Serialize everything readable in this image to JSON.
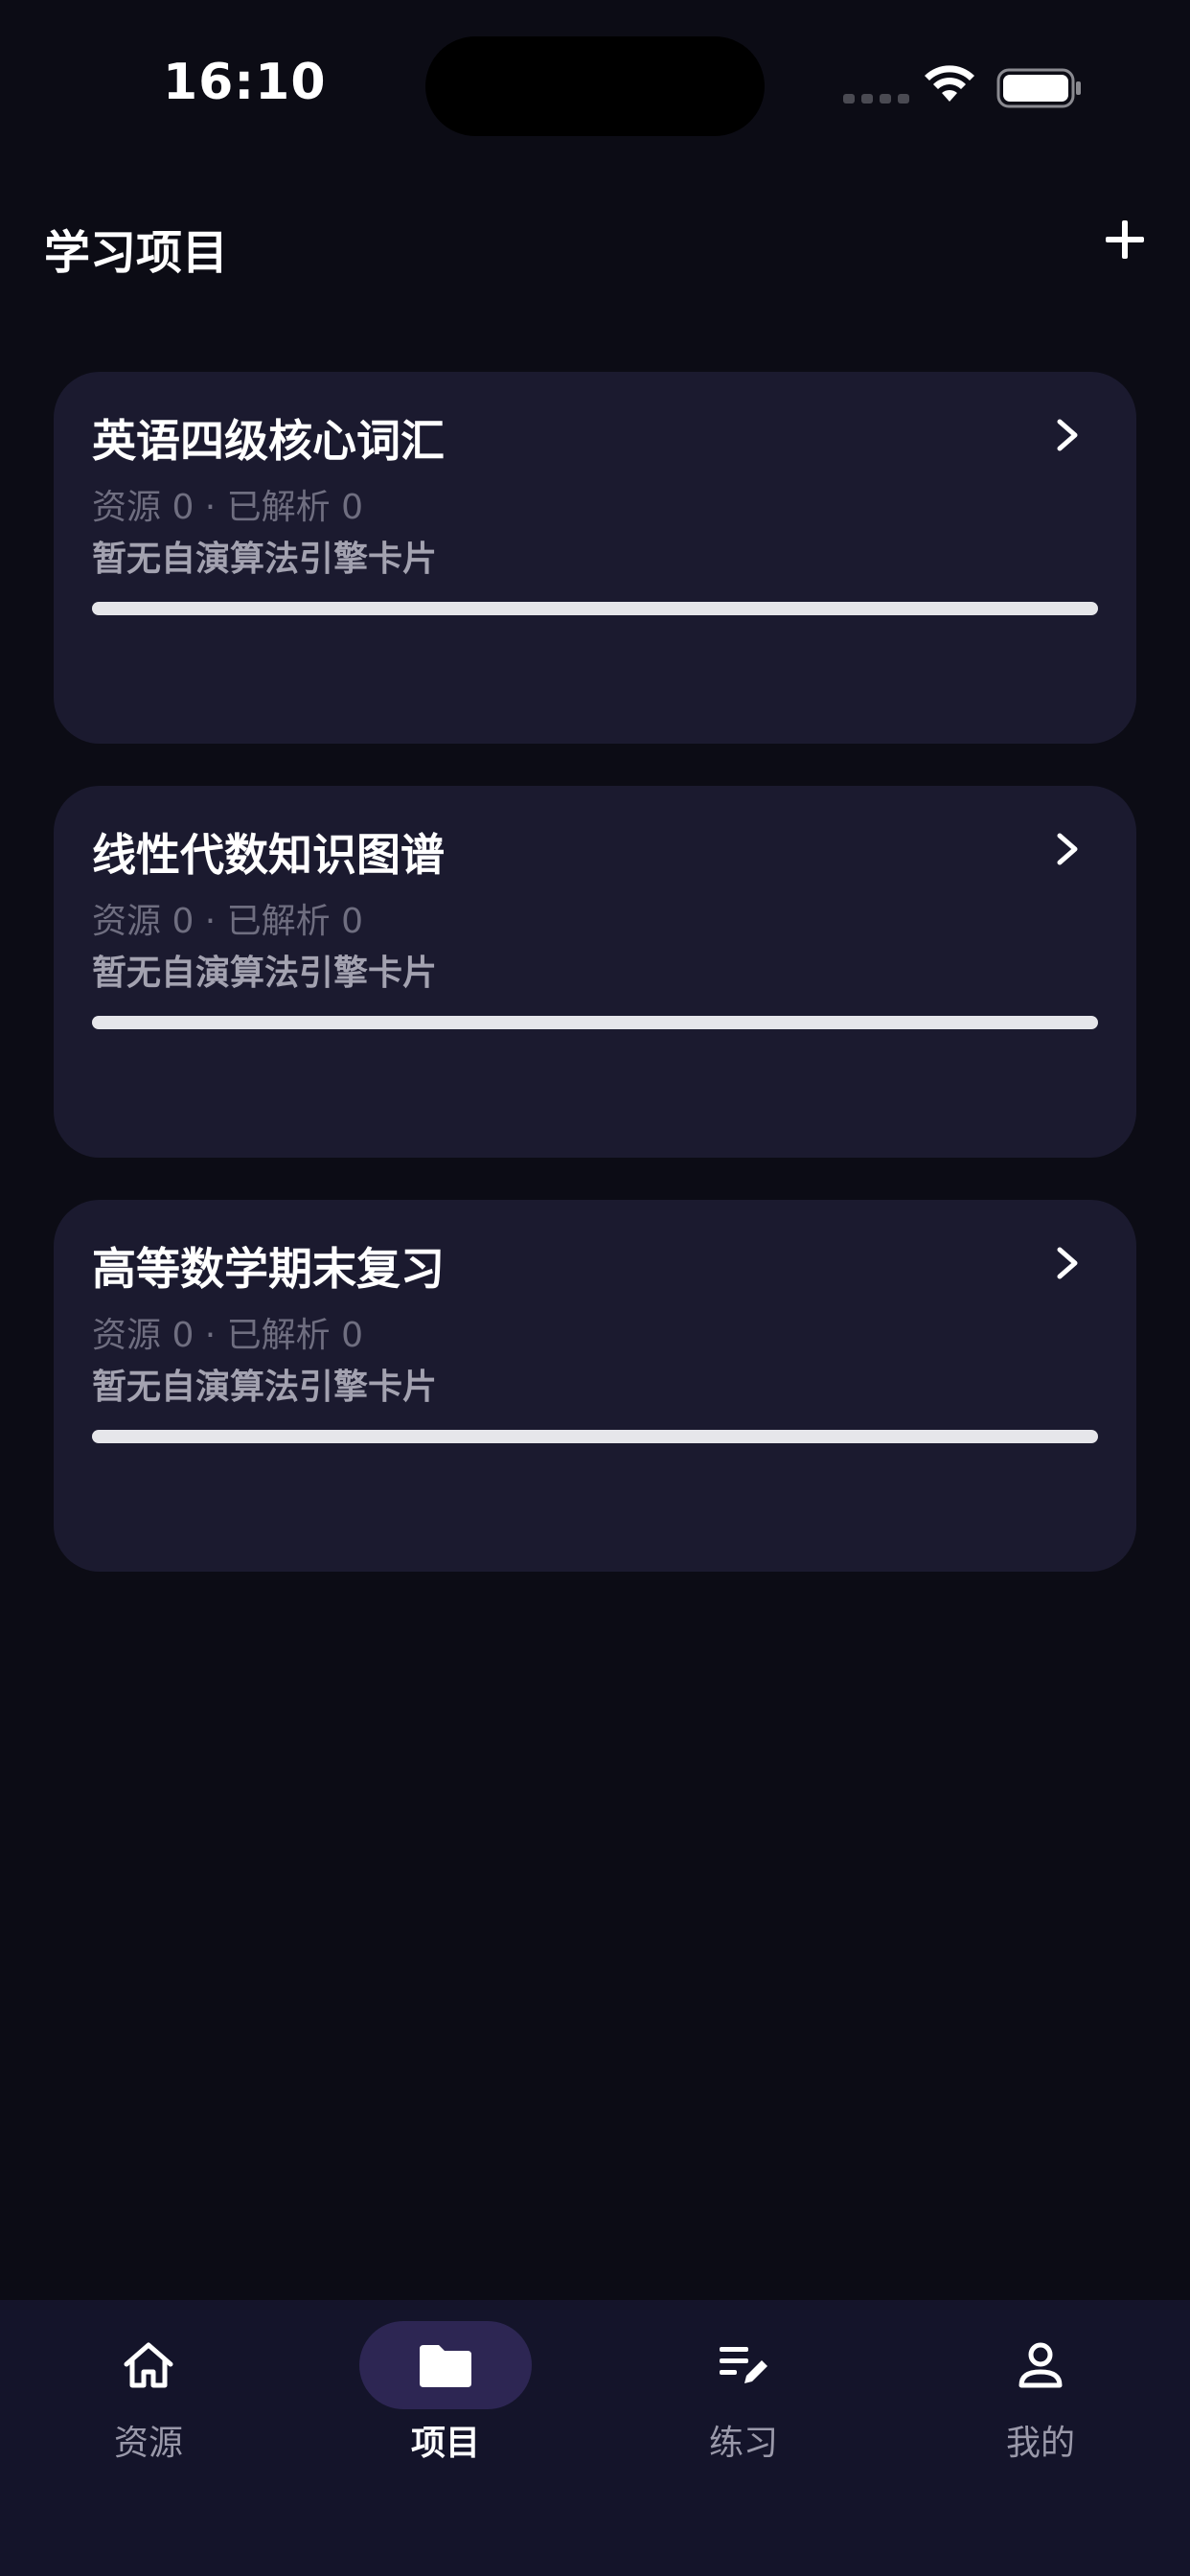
{
  "status_bar": {
    "time": "16:10"
  },
  "header": {
    "title": "学习项目",
    "add_icon": "plus-icon"
  },
  "projects": [
    {
      "title": "英语四级核心词汇",
      "meta": "资源 0 · 已解析 0",
      "subtitle": "暂无自演算法引擎卡片",
      "progress": 0
    },
    {
      "title": "线性代数知识图谱",
      "meta": "资源 0 · 已解析 0",
      "subtitle": "暂无自演算法引擎卡片",
      "progress": 0
    },
    {
      "title": "高等数学期末复习",
      "meta": "资源 0 · 已解析 0",
      "subtitle": "暂无自演算法引擎卡片",
      "progress": 0
    }
  ],
  "tabs": [
    {
      "label": "资源",
      "icon": "home-icon",
      "active": false
    },
    {
      "label": "项目",
      "icon": "folder-icon",
      "active": true
    },
    {
      "label": "练习",
      "icon": "edit-list-icon",
      "active": false
    },
    {
      "label": "我的",
      "icon": "person-icon",
      "active": false
    }
  ],
  "colors": {
    "background": "#0c0c15",
    "card": "#1b1a2f",
    "tab_bar": "#14142a",
    "active_tab_pill": "#2d2653",
    "progress_track": "#e6e6ea"
  }
}
